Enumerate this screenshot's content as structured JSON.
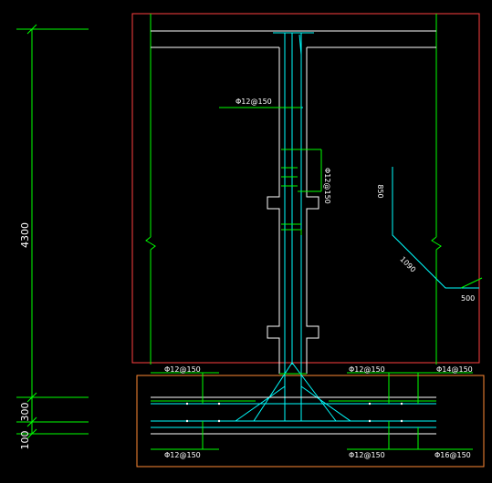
{
  "drawing": {
    "colors": {
      "background": "#000000",
      "wall_outline": "#ffffff",
      "rebar": "#00ffff",
      "dimension": "#00ff00",
      "frame_red": "#ff4040",
      "frame_orange": "#ff8a33"
    },
    "dimensions": {
      "height_main": "4300",
      "height_mid": "300",
      "height_bottom": "100"
    },
    "rebar_labels": {
      "wall_horizontal": "Φ12@150",
      "wall_vertical": "Φ12@150",
      "top_left": "Φ12@150",
      "top_middle": "Φ12@150",
      "top_right": "Φ14@150",
      "bottom_left": "Φ12@150",
      "bottom_middle": "Φ12@150",
      "bottom_right": "Φ16@150"
    },
    "bend_detail": {
      "segment_top": "850",
      "segment_diagonal": "1090",
      "segment_bottom": "500"
    }
  }
}
